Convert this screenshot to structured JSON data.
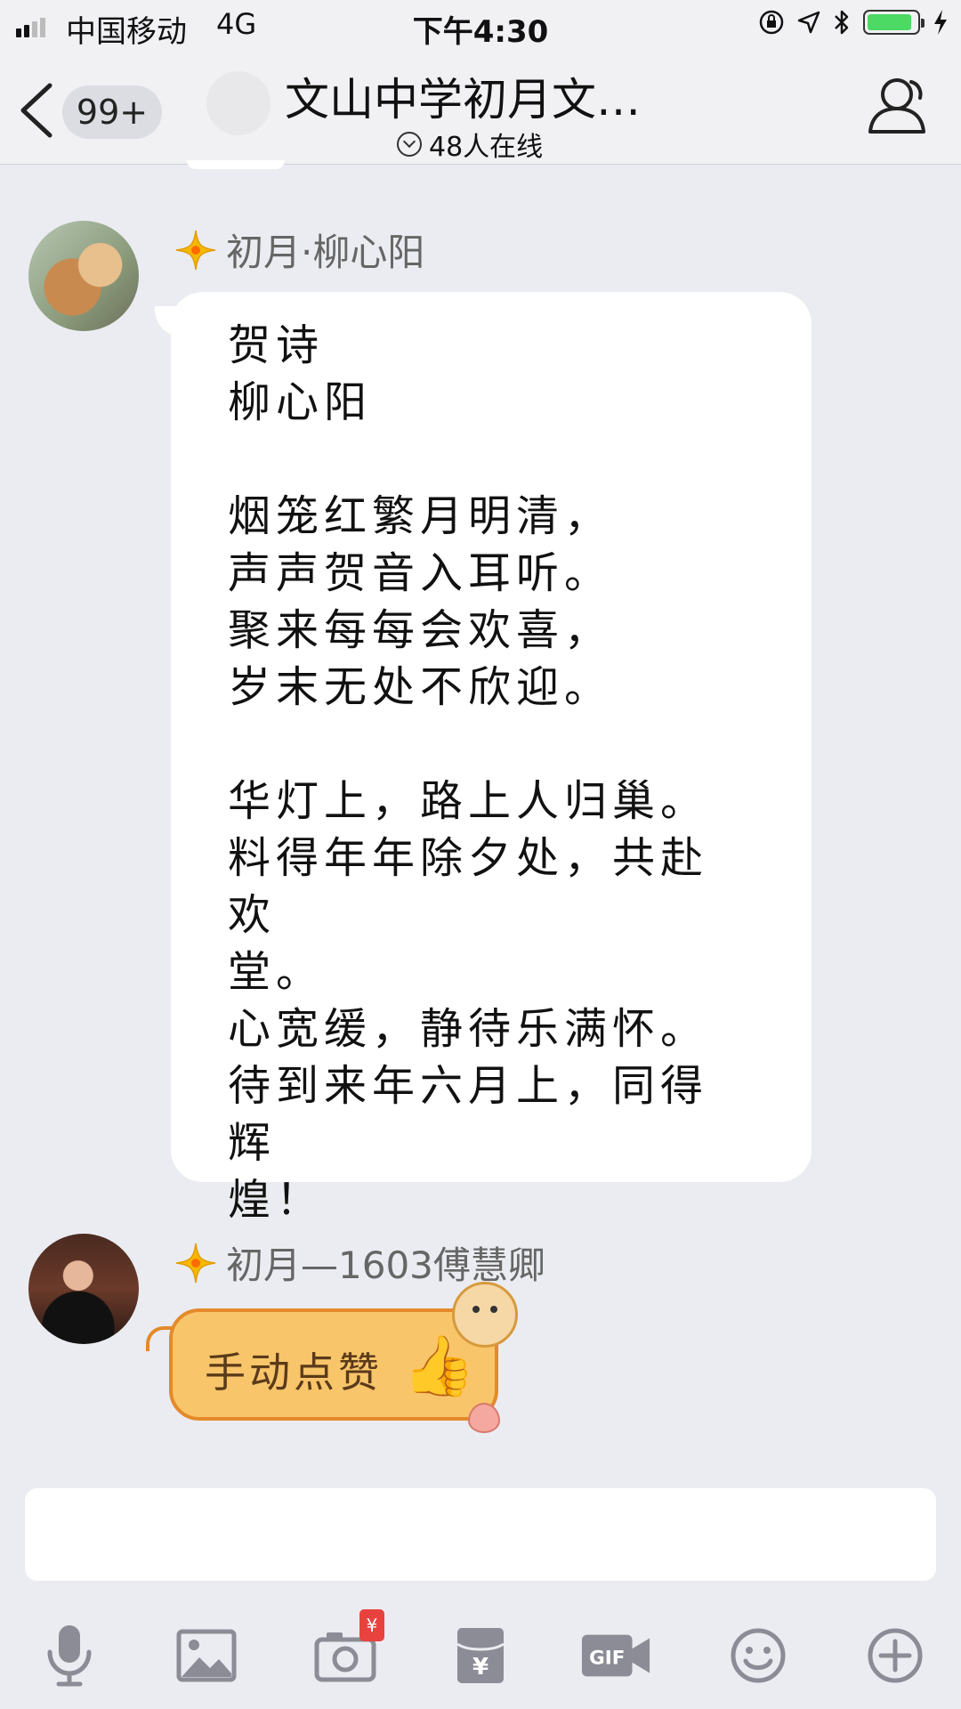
{
  "status_bar": {
    "carrier": "中国移动",
    "network": "4G",
    "time": "下午4:30",
    "battery_level": 0.9
  },
  "header": {
    "unread_count": "99+",
    "title": "文山中学初月文…",
    "online_count": "48人在线"
  },
  "messages": [
    {
      "sender": "初月·柳心阳",
      "lines": [
        "贺诗",
        "柳心阳",
        "",
        "烟笼红繁月明清，",
        "声声贺音入耳听。",
        "聚来每每会欢喜，",
        "岁末无处不欣迎。",
        "",
        "华灯上，路上人归巢。",
        "料得年年除夕处，共赴欢",
        "堂。",
        "心宽缓，静待乐满怀。",
        "待到来年六月上，同得辉",
        "煌！"
      ]
    },
    {
      "sender": "初月—1603傅慧卿",
      "sticker_text": "手动点赞"
    }
  ],
  "input": {
    "placeholder": ""
  },
  "toolbar": {
    "items": [
      "mic-icon",
      "image-icon",
      "camera-icon",
      "red-packet-icon",
      "gif-icon",
      "emoji-icon",
      "plus-icon"
    ],
    "red_packet_badge": "¥"
  },
  "colors": {
    "background": "#ebecf1",
    "bar": "#f1f1f4",
    "sticker": "#f9c56a",
    "badge": "#e8423f"
  }
}
